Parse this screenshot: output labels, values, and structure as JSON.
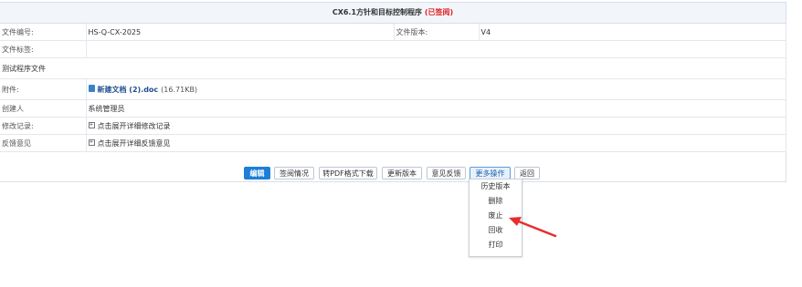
{
  "header": {
    "title": "CX6.1方针和目标控制程序",
    "status": "(已签阅)"
  },
  "fields": {
    "doc_number_label": "文件编号:",
    "doc_number_value": "HS-Q-CX-2025",
    "doc_version_label": "文件版本:",
    "doc_version_value": "V4",
    "doc_tags_label": "文件标签:",
    "description": "测试程序文件",
    "attachment_label": "附件:",
    "attachment_name": "新建文档 (2).doc",
    "attachment_size": "(16.71KB)",
    "creator_label": "创建人",
    "creator_value": "系统管理员",
    "revision_label": "修改记录:",
    "revision_toggle": "点击展开详细修改记录",
    "feedback_label": "反馈意见",
    "feedback_toggle": "点击展开详细反馈意见"
  },
  "toolbar": {
    "edit": "编辑",
    "review_status": "签阅情况",
    "pdf_download": "转PDF格式下载",
    "update_version": "更新版本",
    "feedback": "意见反馈",
    "more_actions": "更多操作",
    "back": "返回"
  },
  "more_menu": {
    "items": [
      "历史版本",
      "删除",
      "废止",
      "回收",
      "打印"
    ]
  },
  "colors": {
    "primary": "#1d7fd6",
    "status_red": "#e02020",
    "arrow_red": "#e53030"
  }
}
